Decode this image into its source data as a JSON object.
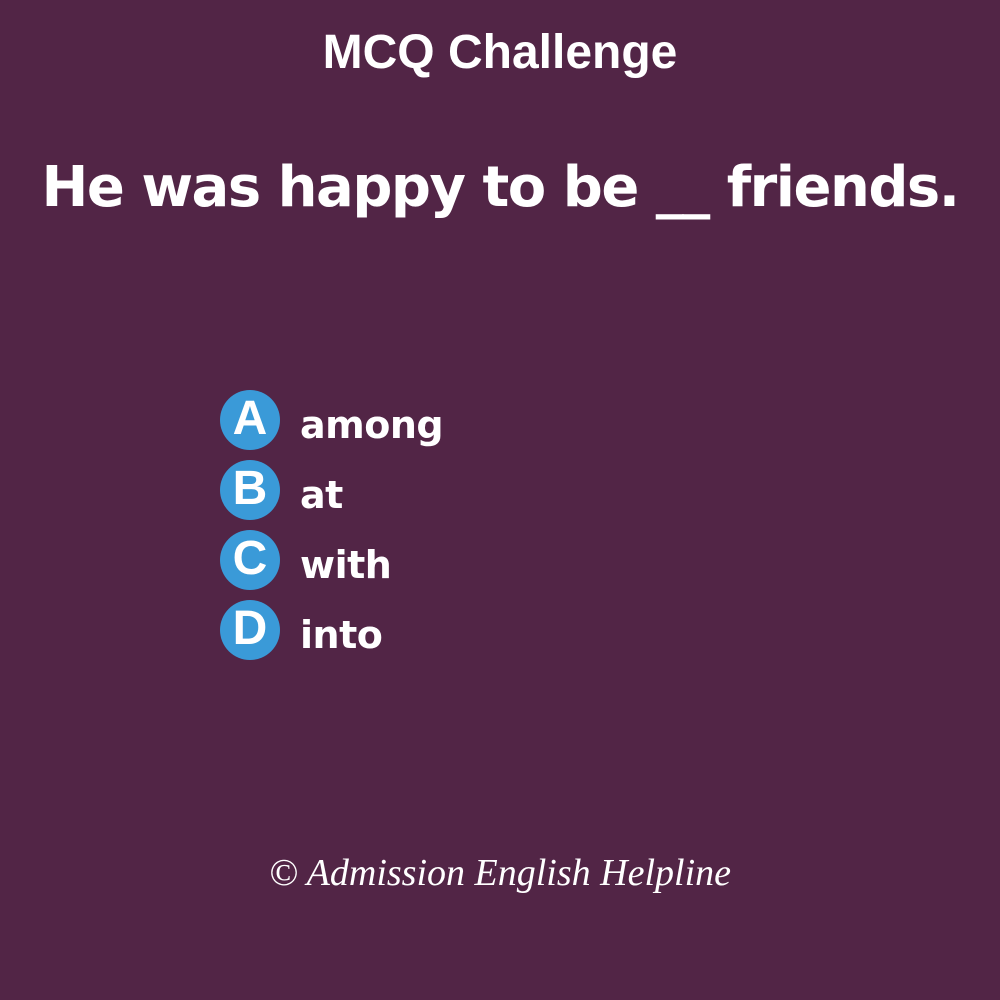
{
  "header": {
    "title": "MCQ Challenge"
  },
  "question": {
    "text": "He was happy to be __ friends."
  },
  "options": [
    {
      "letter": "A",
      "text": "among"
    },
    {
      "letter": "B",
      "text": "at"
    },
    {
      "letter": "C",
      "text": "with"
    },
    {
      "letter": "D",
      "text": "into"
    }
  ],
  "footer": {
    "credit": "© Admission English Helpline"
  },
  "colors": {
    "background": "#522546",
    "badge": "#3a9ad8",
    "text": "#ffffff"
  }
}
